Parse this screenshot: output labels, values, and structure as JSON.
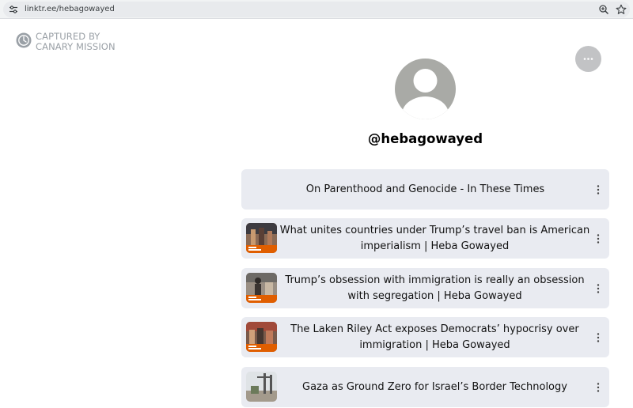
{
  "browser": {
    "url": "linktr.ee/hebagowayed",
    "icons": [
      "site-info-icon",
      "zoom-icon",
      "star-icon"
    ]
  },
  "watermark": {
    "text": "CAPTURED BY\nCANARY MISSION",
    "icon": "canary-logo-icon"
  },
  "header": {
    "more_icon": "ellipsis-icon"
  },
  "profile": {
    "handle": "@hebagowayed",
    "avatar_icon": "default-avatar-icon"
  },
  "links": [
    {
      "title": "On Parenthood and Genocide - In These Times",
      "thumbnail": false
    },
    {
      "title": "What unites countries under Trump’s travel ban is American imperialism | Heba Gowayed",
      "thumbnail": true
    },
    {
      "title": "Trump’s obsession with immigration is really an obsession with segregation | Heba Gowayed",
      "thumbnail": true
    },
    {
      "title": "The Laken Riley Act exposes Democrats’ hypocrisy over immigration | Heba Gowayed",
      "thumbnail": true
    },
    {
      "title": "Gaza as Ground Zero for Israel’s Border Technology",
      "thumbnail": true
    }
  ],
  "colors": {
    "card_bg": "#e9ebf1",
    "avatar_bg": "#a9aaa6",
    "more_button_bg": "#c2c3c5",
    "guardian_orange": "#e05e00"
  }
}
